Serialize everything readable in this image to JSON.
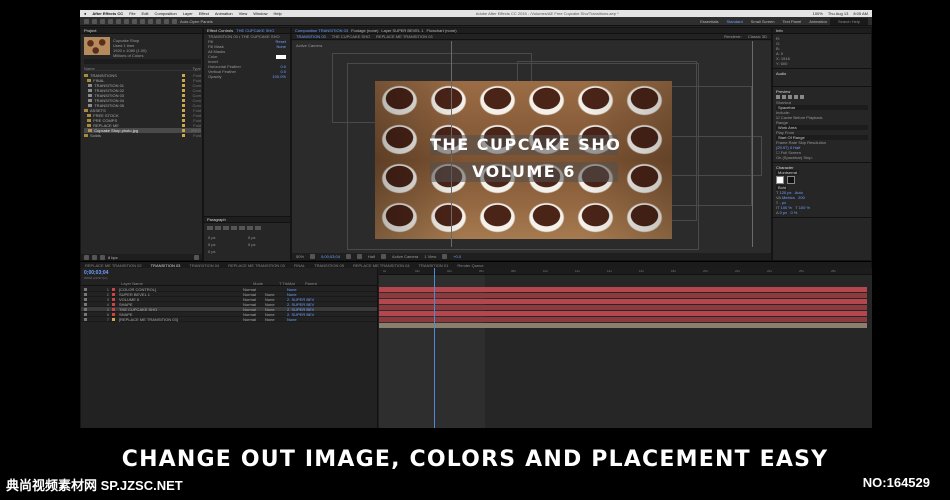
{
  "menubar": {
    "app": "After Effects CC",
    "items": [
      "File",
      "Edit",
      "Composition",
      "Layer",
      "Effect",
      "Animation",
      "View",
      "Window",
      "Help"
    ],
    "title": "Adobe After Effects CC 2015 - /Volumes/AE Free Cupcake Sho/Transitions.aep *",
    "status": [
      "100%",
      "Thu Aug 13",
      "8:05 AM"
    ]
  },
  "toolbar": {
    "snapping": "Auto-Open Panels",
    "workspaces": [
      "Essentials",
      "Standard",
      "Small Screen",
      "Text Panel",
      "Animation"
    ],
    "search": "Search Help"
  },
  "project": {
    "tab": "Project",
    "thumb_info": [
      "Cupcake Shop",
      "Used 1 time",
      "1920 x 1080 (1.00)",
      "Millions of Colors"
    ],
    "columns": [
      "Name",
      "Type"
    ],
    "items": [
      {
        "name": "TRANSITIONS",
        "type": "Fold"
      },
      {
        "name": "FINAL",
        "type": "Fold"
      },
      {
        "name": "TRANSITION 01",
        "type": "Com"
      },
      {
        "name": "TRANSITION 02",
        "type": "Com"
      },
      {
        "name": "TRANSITION 03",
        "type": "Com"
      },
      {
        "name": "TRANSITION 04",
        "type": "Com"
      },
      {
        "name": "TRANSITION 05",
        "type": "Com"
      },
      {
        "name": "ASSETS",
        "type": "Fold"
      },
      {
        "name": "FREE STOCK",
        "type": "Fold"
      },
      {
        "name": "PRE COMPS",
        "type": "Fold"
      },
      {
        "name": "REPLACE ME",
        "type": "Fold"
      },
      {
        "name": "Cupcake Shop photo.jpg",
        "type": "JPEG"
      },
      {
        "name": "Solids",
        "type": "Fold"
      }
    ],
    "footer": "8 bpc"
  },
  "effects": {
    "tab": "Effect Controls",
    "tab_target": "THE CUPCAKE SHO",
    "subtitle": "TRANSITION 03 • THE CUPCAKE SHO",
    "rows": [
      {
        "label": "Fill",
        "value": "Reset"
      },
      {
        "label": "Fill Mask",
        "value": "None"
      },
      {
        "label": "All Masks",
        "value": ""
      },
      {
        "label": "Color",
        "value": ""
      },
      {
        "label": "Invert",
        "value": ""
      },
      {
        "label": "Horizontal Feather",
        "value": "0.0"
      },
      {
        "label": "Vertical Feather",
        "value": "0.0"
      },
      {
        "label": "Opacity",
        "value": "100.0%"
      }
    ]
  },
  "paragraph": {
    "tab": "Paragraph",
    "values": [
      "0 px",
      "0 px",
      "0 px",
      "0 px",
      "0 px"
    ]
  },
  "comp": {
    "tab": "Composition TRANSITION 03",
    "other_tabs": [
      "Footage (none)",
      "Layer SUPER BEVEL 1",
      "Flowchart (none)"
    ],
    "subtabs": [
      "TRANSITION 03",
      "THE CUPCAKE SHO",
      "REPLACE ME TRANSITION 03"
    ],
    "renderer_label": "Renderer:",
    "renderer": "Classic 3D",
    "active_camera": "Active Camera",
    "title_line1": "THE CUPCAKE SHO",
    "title_line2": "VOLUME 6",
    "footer": {
      "zoom": "50%",
      "timecode": "0;00;03;04",
      "resolution": "Half",
      "camera": "Active Camera",
      "view": "1 View",
      "exposure": "+0.0"
    }
  },
  "right": {
    "info_tab": "Info",
    "info": [
      "R:",
      "G:",
      "B:",
      "A: 0",
      "X: 1516",
      "Y: 600"
    ],
    "audio_tab": "Audio",
    "preview_tab": "Preview",
    "preview": {
      "shortcut_label": "Shortcut",
      "shortcut": "Spacebar",
      "include": "Include:",
      "cache": "Cache Before Playback",
      "range_label": "Range",
      "range": "Work Area",
      "play_from": "Play From",
      "play_from_val": "Start Of Range",
      "frame_rate": "Frame Rate",
      "skip": "Skip",
      "resolution": "Resolution",
      "fps": "(29.97)",
      "skip_val": "0",
      "res_val": "Half",
      "full_screen": "Full Screen",
      "stop": "On (Spacebar) Stop:"
    },
    "character_tab": "Character",
    "character": {
      "font": "Montserrat",
      "style": "Bold",
      "size": "120 px",
      "leading": "Auto",
      "tracking": "200",
      "metrics": "Metrics",
      "stroke": "- px",
      "vscale": "100 %",
      "hscale": "100 %",
      "baseline": "0 px",
      "tsume": "0 %"
    }
  },
  "timeline": {
    "tabs": [
      "REPLACE ME TRANSITION 02",
      "TRANSITION 03",
      "TRANSITION 04",
      "REPLACE ME TRANSITION 03",
      "FINAL",
      "TRANSITION 05",
      "REPLACE ME TRANSITION 04",
      "TRANSITION 01",
      "Render Queue"
    ],
    "active_tab": "TRANSITION 03",
    "timecode": "0;00;03;04",
    "timecode_sub": "00094 (29.97 fps)",
    "columns": [
      "Layer Name",
      "Mode",
      "T TrkMat",
      "Parent"
    ],
    "layers": [
      {
        "num": "1",
        "name": "[COLOR CONTROL]",
        "mode": "Normal",
        "trkmat": "",
        "parent": "None",
        "color": "#c94545"
      },
      {
        "num": "2",
        "name": "SUPER BEVEL 1",
        "mode": "Normal",
        "trkmat": "None",
        "parent": "None",
        "color": "#c94545"
      },
      {
        "num": "3",
        "name": "VOLUME 6",
        "mode": "Normal",
        "trkmat": "None",
        "parent": "2. SUPER BEV",
        "color": "#c94545"
      },
      {
        "num": "4",
        "name": "SHAPE",
        "mode": "Normal",
        "trkmat": "None",
        "parent": "2. SUPER BEV",
        "color": "#c94545"
      },
      {
        "num": "5",
        "name": "THE CUPCAKE SHO",
        "mode": "Normal",
        "trkmat": "None",
        "parent": "2. SUPER BEV",
        "color": "#c94545"
      },
      {
        "num": "6",
        "name": "SHAPE",
        "mode": "Normal",
        "trkmat": "None",
        "parent": "2. SUPER BEV",
        "color": "#c94545"
      },
      {
        "num": "7",
        "name": "[REPLACE ME TRANSITION 03]",
        "mode": "Normal",
        "trkmat": "None",
        "parent": "None",
        "color": "#c9a94a"
      }
    ],
    "ruler": [
      "0s",
      "02s",
      "04s",
      "06s",
      "08s",
      "10s",
      "12s",
      "14s",
      "16s",
      "18s",
      "20s",
      "22s",
      "24s",
      "26s",
      "28s"
    ]
  },
  "caption": "CHANGE OUT IMAGE, COLORS AND PLACEMENT EASY",
  "watermark_left": "典尚视频素材网 SP.JZSC.NET",
  "watermark_right": "NO:164529"
}
